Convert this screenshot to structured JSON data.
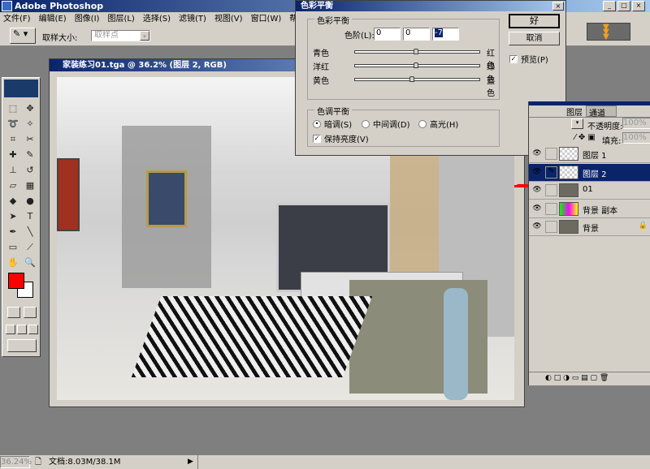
{
  "app": {
    "title": "Adobe Photoshop"
  },
  "menu": [
    "文件(F)",
    "编辑(E)",
    "图像(I)",
    "图层(L)",
    "选择(S)",
    "滤镜(T)",
    "视图(V)",
    "窗口(W)",
    "帮助(H)"
  ],
  "options": {
    "sample_size_label": "取样大小:",
    "sample_size_value": "取样点"
  },
  "document": {
    "title": "家装练习01.tga @ 36.2% (图层 2, RGB)"
  },
  "dialog": {
    "title": "色彩平衡",
    "group1": "色彩平衡",
    "levels_label": "色阶(L):",
    "levels": [
      "0",
      "0",
      "-7"
    ],
    "sliders": [
      {
        "left": "青色",
        "right": "红色",
        "value": 0
      },
      {
        "left": "洋红",
        "right": "绿色",
        "value": 0
      },
      {
        "left": "黄色",
        "right": "蓝色",
        "value": -7
      }
    ],
    "group2": "色调平衡",
    "tones": [
      "暗调(S)",
      "中间调(D)",
      "高光(H)"
    ],
    "selected_tone": "暗调(S)",
    "preserve": "保持亮度(V)",
    "ok": "好",
    "cancel": "取消",
    "preview": "预览(P)"
  },
  "layers": {
    "tabs": [
      "图层",
      "通道"
    ],
    "opacity_label": "不透明度:",
    "opacity": "100%",
    "fill_label": "填充:",
    "fill": "100%",
    "items": [
      {
        "name": "图层 1",
        "selected": false
      },
      {
        "name": "图层 2",
        "selected": true
      },
      {
        "name": "01",
        "selected": false
      },
      {
        "name": "背景 副本",
        "selected": false
      },
      {
        "name": "背景",
        "selected": false,
        "locked": true
      }
    ]
  },
  "status": {
    "zoom": "36.24%",
    "doc": "文档:8.03M/38.1M"
  },
  "colors": {
    "foreground": "#ff0000",
    "background": "#ffffff",
    "title": "#0a246a",
    "annotation": "#ff0000"
  }
}
